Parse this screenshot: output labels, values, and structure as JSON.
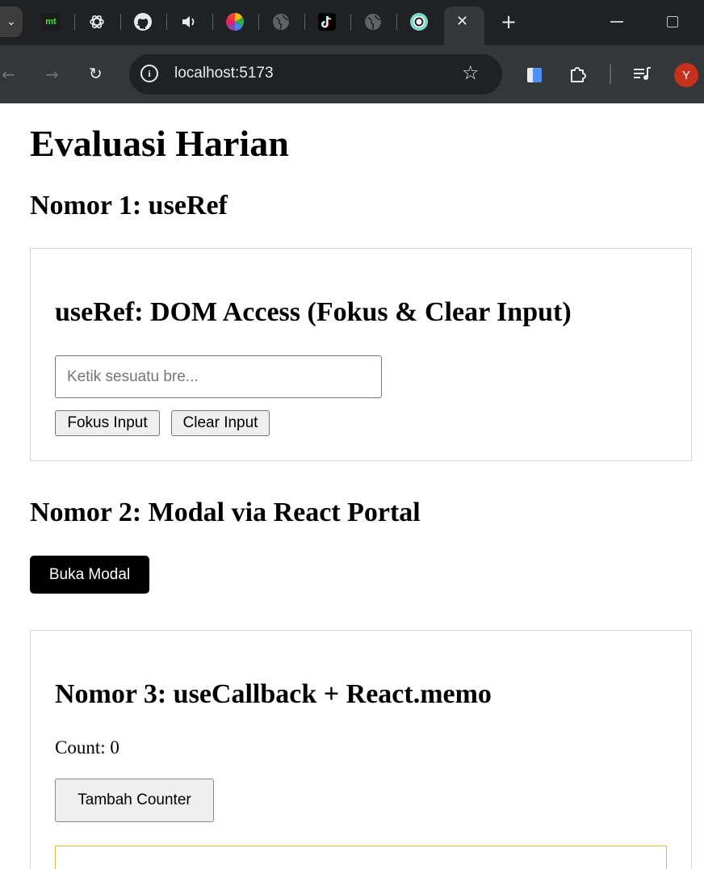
{
  "browser": {
    "url": "localhost:5173",
    "pinned_tabs": [
      {
        "icon": "monkeytype-icon",
        "text": "mt"
      },
      {
        "icon": "chatgpt-icon"
      },
      {
        "icon": "github-icon"
      },
      {
        "icon": "speaker-icon"
      },
      {
        "icon": "color-wheel-icon"
      },
      {
        "icon": "globe-icon"
      },
      {
        "icon": "tiktok-icon"
      },
      {
        "icon": "globe-icon"
      },
      {
        "icon": "app-ring-icon"
      }
    ],
    "active_tab_close": "✕",
    "new_tab": "+",
    "profile_initial": "Y"
  },
  "page": {
    "title": "Evaluasi Harian",
    "section1": {
      "heading": "Nomor 1: useRef",
      "card_title": "useRef: DOM Access (Fokus & Clear Input)",
      "input_value": "",
      "input_placeholder": "Ketik sesuatu bre...",
      "focus_button": "Fokus Input",
      "clear_button": "Clear Input"
    },
    "section2": {
      "heading": "Nomor 2: Modal via React Portal",
      "open_modal_button": "Buka Modal"
    },
    "section3": {
      "heading": "Nomor 3: useCallback + React.memo",
      "count_label": "Count: 0",
      "increment_button": "Tambah Counter"
    }
  },
  "colors": {
    "chrome_dark": "#202124",
    "toolbar": "#35363a",
    "avatar": "#c5311b",
    "card_border": "#d6d6d6",
    "child_border": "#e8b73a"
  }
}
